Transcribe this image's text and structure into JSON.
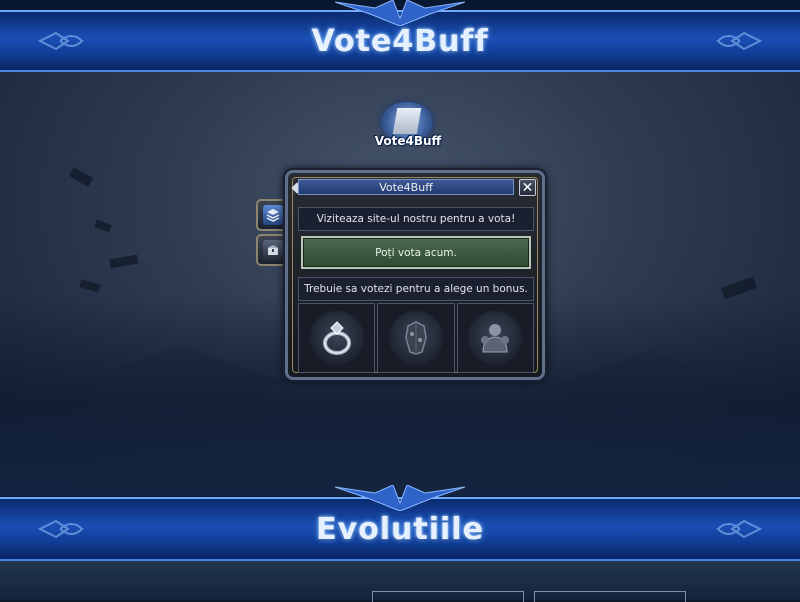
{
  "top_banner": {
    "title": "Vote4Buff"
  },
  "bottom_banner": {
    "title": "Evolutiile"
  },
  "logo": {
    "text": "Vote4Buff",
    "icon": "scroll-icon"
  },
  "side_tabs": [
    {
      "icon": "layers-icon"
    },
    {
      "icon": "chest-icon"
    }
  ],
  "dialog": {
    "title": "Vote4Buff",
    "close_label": "✕",
    "visit_text": "Viziteaza site-ul nostru pentru a vota!",
    "vote_button": "Poți vota acum.",
    "choose_text": "Trebuie sa votezi pentru a alege un bonus.",
    "bonuses": [
      {
        "icon": "ring-icon"
      },
      {
        "icon": "armor-icon"
      },
      {
        "icon": "warrior-icon"
      }
    ]
  },
  "colors": {
    "banner_blue": "#1a4fb5",
    "banner_text": "#e6f0ff",
    "vote_button": "#3d5a40"
  }
}
